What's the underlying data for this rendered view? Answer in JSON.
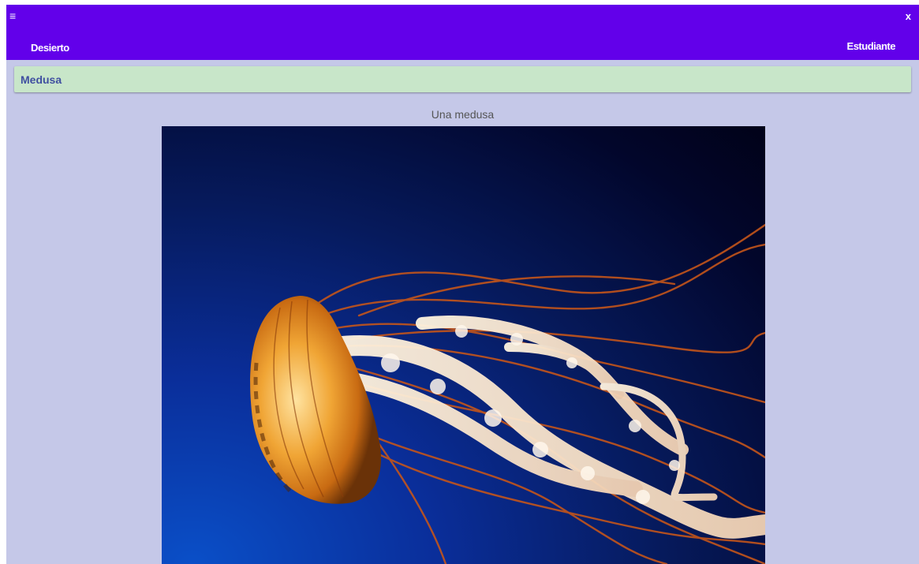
{
  "header": {
    "menu_icon": "hamburger-menu-icon",
    "close_icon": "close-icon",
    "close_glyph": "x",
    "left_link": "Desierto",
    "right_link": "Estudiante",
    "background": "#6200ea"
  },
  "section": {
    "title": "Medusa",
    "background": "#c8e6c9",
    "title_color": "#3f4fa0"
  },
  "content": {
    "caption": "Una medusa",
    "image_subject": "jellyfish",
    "page_background": "#c5c8e8"
  }
}
